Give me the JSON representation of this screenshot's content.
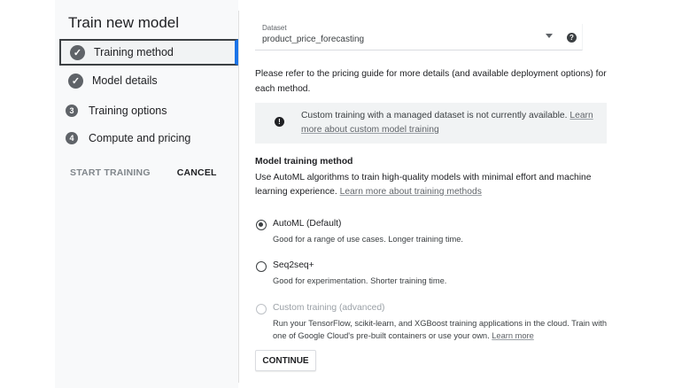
{
  "panel": {
    "title": "Train new model",
    "steps": [
      {
        "label": "Training method",
        "marker": "✓",
        "state": "complete-active"
      },
      {
        "label": "Model details",
        "marker": "✓",
        "state": "complete"
      },
      {
        "label": "Training options",
        "marker": "3",
        "state": "pending"
      },
      {
        "label": "Compute and pricing",
        "marker": "4",
        "state": "pending"
      }
    ],
    "start_training_label": "START TRAINING",
    "cancel_label": "CANCEL"
  },
  "dataset": {
    "label": "Dataset",
    "value": "product_price_forecasting",
    "help_marker": "?"
  },
  "pricing_text": "Please refer to the pricing guide for more details (and available deployment options) for each method.",
  "info_banner": {
    "icon_marker": "!",
    "text": "Custom training with a managed dataset is not currently available. ",
    "link": "Learn more about custom model training"
  },
  "method": {
    "title": "Model training method",
    "description": "Use AutoML algorithms to train high-quality models with minimal effort and machine learning experience. ",
    "link": "Learn more about training methods",
    "options": [
      {
        "title": "AutoML (Default)",
        "description": "Good for a range of use cases. Longer training time.",
        "selected": true,
        "disabled": false
      },
      {
        "title": "Seq2seq+",
        "description": "Good for experimentation. Shorter training time.",
        "selected": false,
        "disabled": false
      },
      {
        "title": "Custom training (advanced)",
        "description": "Run your TensorFlow, scikit-learn, and XGBoost training applications in the cloud. Train with one of Google Cloud's pre-built containers or use your own. ",
        "link": "Learn more",
        "selected": false,
        "disabled": true
      }
    ]
  },
  "continue_label": "CONTINUE",
  "colors": {
    "accent_blue": "#1a73e8",
    "icon_gray": "#5f6368",
    "panel_bg": "#f8f9fa",
    "banner_bg": "#f1f3f4"
  }
}
